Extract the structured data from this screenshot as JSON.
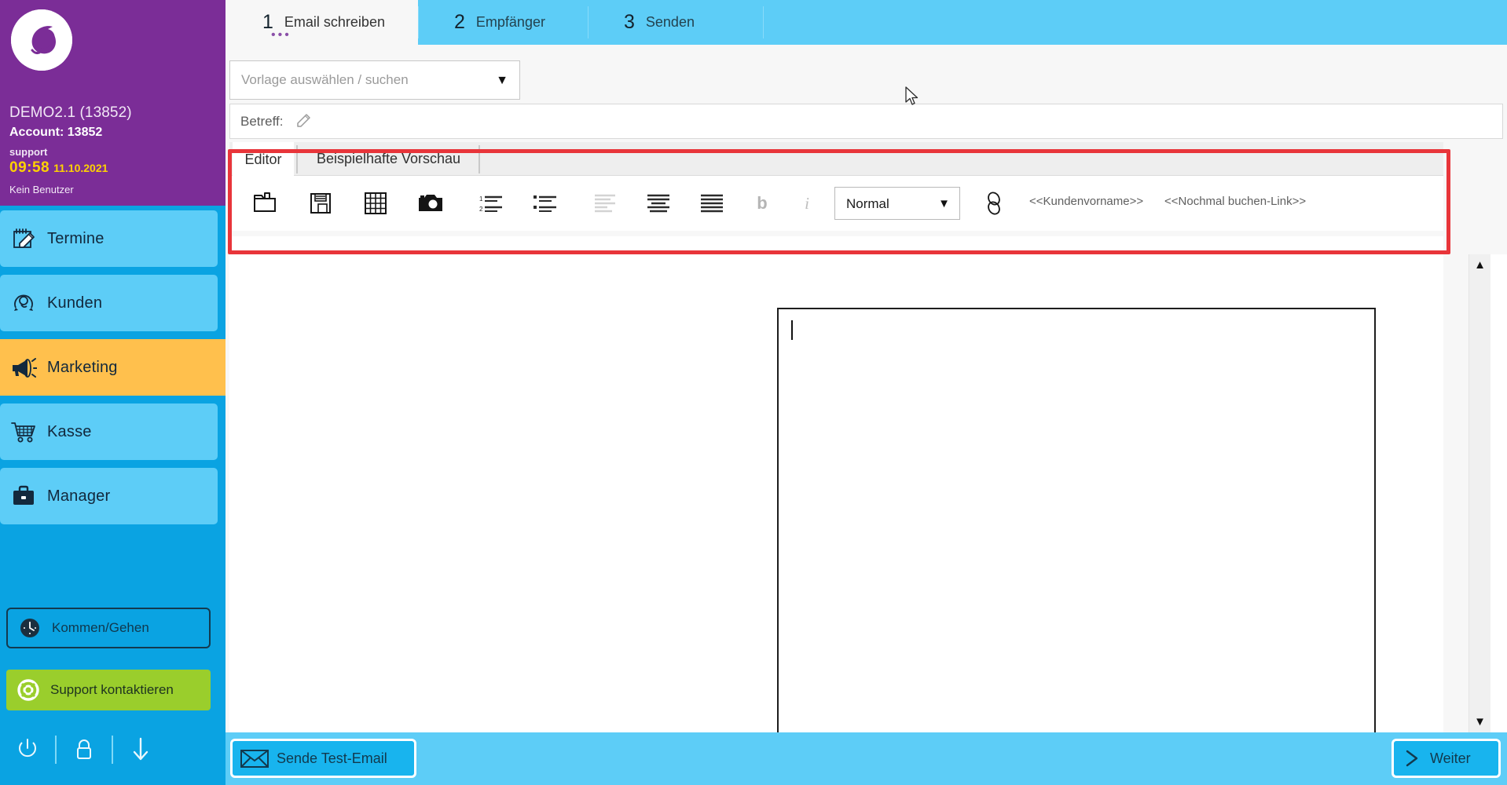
{
  "sidebar": {
    "account_name": "DEMO2.1 (13852)",
    "account_line": "Account: 13852",
    "role": "support",
    "time": "09:58",
    "date": "11.10.2021",
    "user": "Kein Benutzer",
    "items": [
      {
        "label": "Termine",
        "icon": "calendar-edit-icon",
        "active": false
      },
      {
        "label": "Kunden",
        "icon": "customers-icon",
        "active": false
      },
      {
        "label": "Marketing",
        "icon": "megaphone-icon",
        "active": true
      },
      {
        "label": "Kasse",
        "icon": "shopping-cart-icon",
        "active": false
      },
      {
        "label": "Manager",
        "icon": "briefcase-icon",
        "active": false
      }
    ],
    "come_go_label": "Kommen/Gehen",
    "support_label": "Support kontaktieren",
    "footer_icons": [
      "power-icon",
      "lock-icon",
      "arrow-down-icon"
    ],
    "colors": {
      "header": "#7b2d97",
      "nav": "#0aa3e2",
      "active": "#ffc04d",
      "support": "#9ace2c"
    }
  },
  "tabs": [
    {
      "num": "1",
      "label": "Email schreiben",
      "active": true
    },
    {
      "num": "2",
      "label": "Empfänger",
      "active": false
    },
    {
      "num": "3",
      "label": "Senden",
      "active": false
    }
  ],
  "template_select": {
    "placeholder": "Vorlage auswählen / suchen",
    "arrow": "▼"
  },
  "subject": {
    "label": "Betreff:",
    "value": "",
    "icon": "pencil-icon"
  },
  "editor_tabs": [
    {
      "label": "Editor",
      "active": true
    },
    {
      "label": "Beispielhafte Vorschau",
      "active": false
    }
  ],
  "toolbar": {
    "buttons": [
      {
        "name": "open-folder-icon",
        "title": "Öffnen"
      },
      {
        "name": "save-floppy-icon",
        "title": "Speichern"
      },
      {
        "name": "table-grid-icon",
        "title": "Tabelle"
      },
      {
        "name": "camera-image-icon",
        "title": "Bild"
      },
      {
        "name": "ordered-list-icon",
        "title": "Nummerierte Liste"
      },
      {
        "name": "unordered-list-icon",
        "title": "Aufzählung"
      },
      {
        "name": "align-left-icon",
        "title": "Linksbündig"
      },
      {
        "name": "align-center-icon",
        "title": "Zentriert"
      },
      {
        "name": "align-right-icon",
        "title": "Rechtsbündig"
      },
      {
        "name": "bold-icon",
        "title": "Fett"
      },
      {
        "name": "italic-icon",
        "title": "Kursiv"
      }
    ],
    "bold_label": "b",
    "italic_label": "i",
    "style_select": {
      "value": "Normal",
      "arrow": "▼"
    },
    "link_icon": "link-chain-icon",
    "tokens": [
      "<<Kundenvorname>>",
      "<<Nochmal buchen-Link>>"
    ],
    "highlight_color": "#e8353a"
  },
  "editor_body": {
    "content": ""
  },
  "scrollbar": {
    "up": "▲",
    "down": "▼"
  },
  "bottom": {
    "test_email_label": "Sende Test-Email",
    "test_email_icon": "envelope-icon",
    "next_label": "Weiter",
    "next_icon": "chevron-right-icon"
  }
}
